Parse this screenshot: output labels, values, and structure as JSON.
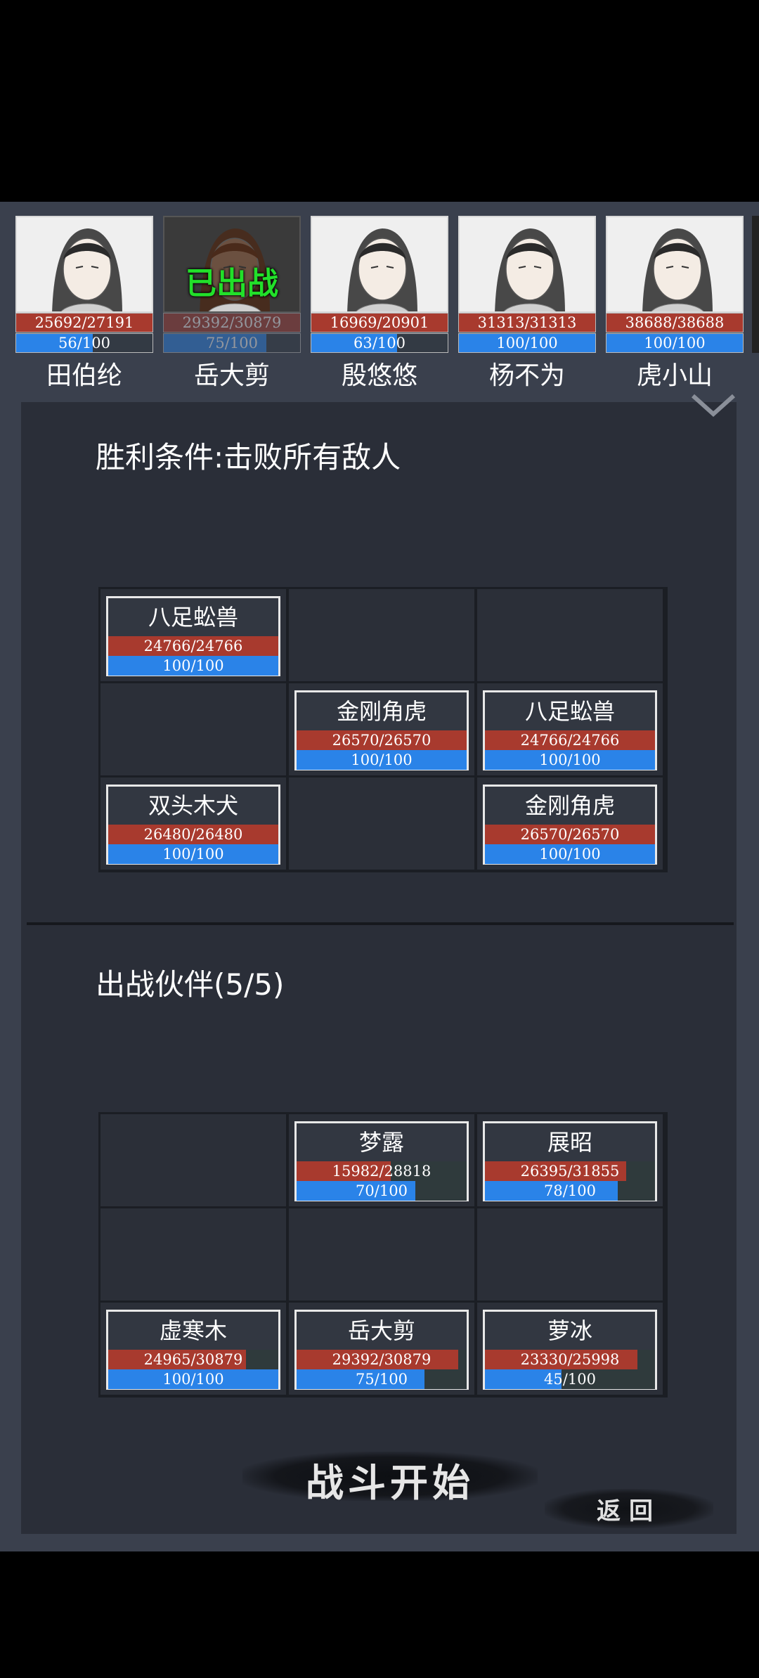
{
  "roster": [
    {
      "name": "田伯纶",
      "hp": "25692/27191",
      "hp_frac": 0.945,
      "mp": "56/100",
      "mp_frac": 0.56,
      "deployed": false,
      "tag": ""
    },
    {
      "name": "岳大剪",
      "hp": "29392/30879",
      "hp_frac": 0.952,
      "mp": "75/100",
      "mp_frac": 0.75,
      "deployed": true,
      "tag": "已出战"
    },
    {
      "name": "殷悠悠",
      "hp": "16969/20901",
      "hp_frac": 0.812,
      "mp": "63/100",
      "mp_frac": 0.63,
      "deployed": false,
      "tag": ""
    },
    {
      "name": "杨不为",
      "hp": "31313/31313",
      "hp_frac": 1.0,
      "mp": "100/100",
      "mp_frac": 1.0,
      "deployed": false,
      "tag": ""
    },
    {
      "name": "虎小山",
      "hp": "38688/38688",
      "hp_frac": 1.0,
      "mp": "100/100",
      "mp_frac": 1.0,
      "deployed": false,
      "tag": ""
    }
  ],
  "victory": {
    "title": "胜利条件:击败所有敌人"
  },
  "enemies": [
    {
      "cell": 0,
      "name": "八足蚣兽",
      "hp": "24766/24766",
      "hp_frac": 1.0,
      "mp": "100/100",
      "mp_frac": 1.0
    },
    {
      "cell": 4,
      "name": "金刚角虎",
      "hp": "26570/26570",
      "hp_frac": 1.0,
      "mp": "100/100",
      "mp_frac": 1.0
    },
    {
      "cell": 5,
      "name": "八足蚣兽",
      "hp": "24766/24766",
      "hp_frac": 1.0,
      "mp": "100/100",
      "mp_frac": 1.0
    },
    {
      "cell": 6,
      "name": "双头木犬",
      "hp": "26480/26480",
      "hp_frac": 1.0,
      "mp": "100/100",
      "mp_frac": 1.0
    },
    {
      "cell": 8,
      "name": "金刚角虎",
      "hp": "26570/26570",
      "hp_frac": 1.0,
      "mp": "100/100",
      "mp_frac": 1.0
    }
  ],
  "party": {
    "title": "出战伙伴(5/5)"
  },
  "allies": [
    {
      "cell": 1,
      "name": "梦露",
      "hp": "15982/28818",
      "hp_frac": 0.555,
      "mp": "70/100",
      "mp_frac": 0.7
    },
    {
      "cell": 2,
      "name": "展昭",
      "hp": "26395/31855",
      "hp_frac": 0.829,
      "mp": "78/100",
      "mp_frac": 0.78
    },
    {
      "cell": 6,
      "name": "虚寒木",
      "hp": "24965/30879",
      "hp_frac": 0.808,
      "mp": "100/100",
      "mp_frac": 1.0
    },
    {
      "cell": 7,
      "name": "岳大剪",
      "hp": "29392/30879",
      "hp_frac": 0.952,
      "mp": "75/100",
      "mp_frac": 0.75
    },
    {
      "cell": 8,
      "name": "萝冰",
      "hp": "23330/25998",
      "hp_frac": 0.897,
      "mp": "45/100",
      "mp_frac": 0.45
    }
  ],
  "buttons": {
    "start": "战斗开始",
    "back": "返回"
  },
  "icons": {
    "collapse": "chevron-down-icon"
  },
  "colors": {
    "hp": "#a83a2e",
    "mp": "#2a83e8",
    "deployed": "#22e02a",
    "panel": "#2a2e38"
  }
}
